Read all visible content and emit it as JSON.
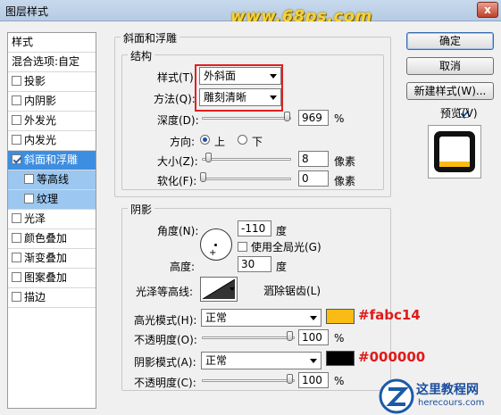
{
  "window": {
    "title": "图层样式",
    "watermark": "www.68ps.com",
    "close_label": "x"
  },
  "sidebar": {
    "header": "样式",
    "blend": "混合选项:自定",
    "items": [
      {
        "label": "投影",
        "checked": false
      },
      {
        "label": "内阴影",
        "checked": false
      },
      {
        "label": "外发光",
        "checked": false
      },
      {
        "label": "内发光",
        "checked": false
      },
      {
        "label": "斜面和浮雕",
        "checked": true
      },
      {
        "label": "等高线",
        "checked": false
      },
      {
        "label": "纹理",
        "checked": false
      },
      {
        "label": "光泽",
        "checked": false
      },
      {
        "label": "颜色叠加",
        "checked": false
      },
      {
        "label": "渐变叠加",
        "checked": false
      },
      {
        "label": "图案叠加",
        "checked": false
      },
      {
        "label": "描边",
        "checked": false
      }
    ]
  },
  "bevel": {
    "group_title": "斜面和浮雕",
    "structure_title": "结构",
    "style_label": "样式(T):",
    "style_value": "外斜面",
    "technique_label": "方法(Q):",
    "technique_value": "雕刻清晰",
    "depth_label": "深度(D):",
    "depth_value": "969",
    "depth_unit": "%",
    "direction_label": "方向:",
    "direction_up": "上",
    "direction_down": "下",
    "size_label": "大小(Z):",
    "size_value": "8",
    "size_unit": "像素",
    "soften_label": "软化(F):",
    "soften_value": "0",
    "soften_unit": "像素"
  },
  "shading": {
    "group_title": "阴影",
    "angle_label": "角度(N):",
    "angle_value": "-110",
    "angle_unit": "度",
    "global_light_label": "使用全局光(G)",
    "altitude_label": "高度:",
    "altitude_value": "30",
    "altitude_unit": "度",
    "gloss_label": "光泽等高线:",
    "antialias_label": "消除锯齿(L)",
    "highlight_label": "高光模式(H):",
    "highlight_mode": "正常",
    "highlight_color": "#fabc14",
    "highlight_color_anno": "#fabc14",
    "opacity1_label": "不透明度(O):",
    "opacity1_value": "100",
    "opacity1_unit": "%",
    "shadow_label": "阴影模式(A):",
    "shadow_mode": "正常",
    "shadow_color": "#000000",
    "shadow_color_anno": "#000000",
    "opacity2_label": "不透明度(C):",
    "opacity2_value": "100",
    "opacity2_unit": "%"
  },
  "buttons": {
    "ok": "确定",
    "cancel": "取消",
    "new_style": "新建样式(W)...",
    "preview": "预览(V)"
  },
  "logo": {
    "text": "这里教程网",
    "sub": "herecours.com"
  }
}
